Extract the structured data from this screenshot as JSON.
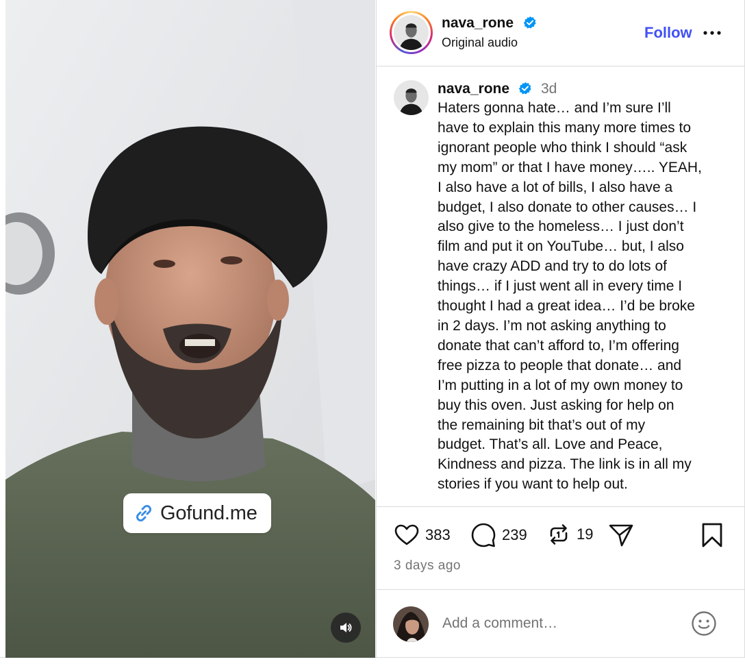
{
  "media": {
    "sticker_text": "Gofund.me",
    "icons": {
      "link": "link-icon",
      "mute": "speaker-icon"
    }
  },
  "header": {
    "username": "nava_rone",
    "audio_label": "Original audio",
    "follow_label": "Follow",
    "more_icon": "more-horizontal-icon",
    "verified_icon": "verified-badge-icon"
  },
  "caption": {
    "username": "nava_rone",
    "time": "3d",
    "text": "Haters gonna hate… and I’m sure I’ll\nhave to explain this many more times to\nignorant people who think I should “ask\nmy mom” or that I have money….. YEAH,\nI also have a lot of bills, I also have a\nbudget, I also donate to other causes… I\nalso give to the homeless… I just don’t\nfilm and put it on YouTube… but, I also\nhave crazy ADD and try to do lots of\nthings… if I just went all in every time I\nthought I had a great idea… I’d be broke\nin 2 days. I’m not asking anything to\ndonate that can’t afford to, I’m offering\nfree pizza to people that donate… and\nI’m putting in a lot of my own money to\nbuy this oven. Just asking for help on\nthe remaining bit that’s out of my\nbudget. That’s all. Love and Peace,\nKindness and pizza. The link is in all my\nstories if you want to help out."
  },
  "actions": {
    "likes": "383",
    "comments": "239",
    "reposts": "19",
    "icons": [
      "heart-icon",
      "comment-icon",
      "repost-icon",
      "share-icon",
      "bookmark-icon"
    ]
  },
  "posted": "3 days ago",
  "comment_box": {
    "placeholder": "Add a comment…",
    "emoji_icon": "emoji-icon"
  },
  "colors": {
    "accent": "#4150f7",
    "verified": "#0095f6",
    "secondary_text": "#737373",
    "border": "#dbdbdb"
  }
}
